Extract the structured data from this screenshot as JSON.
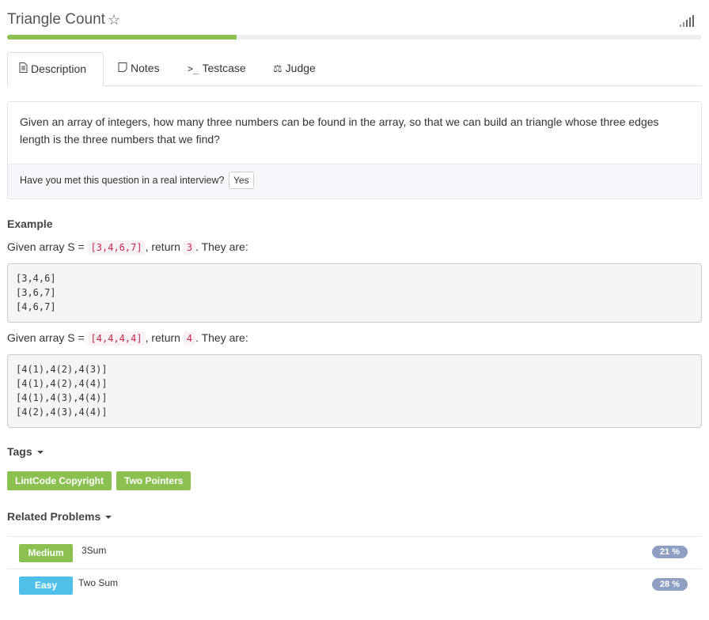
{
  "problem": {
    "title": "Triangle Count",
    "star_icon": "star-icon",
    "difficulty_icon": "signal-bars-icon",
    "progress_fraction": 0.33
  },
  "tabs": [
    {
      "label": "Description",
      "icon": "document-icon",
      "active": true
    },
    {
      "label": "Notes",
      "icon": "note-icon",
      "active": false
    },
    {
      "label": "Testcase",
      "icon": "terminal-icon",
      "active": false
    },
    {
      "label": "Judge",
      "icon": "scale-icon",
      "active": false
    }
  ],
  "description": {
    "text": "Given an array of integers, how many three numbers can be found in the array, so that we can build an triangle whose three edges length is the three numbers that we find?",
    "interview_question": "Have you met this question in a real interview?",
    "yes_label": "Yes"
  },
  "example": {
    "heading": "Example",
    "cases": [
      {
        "prefix": "Given array S = ",
        "array": "[3,4,6,7]",
        "middle": ", return ",
        "result": "3",
        "suffix": ". They are:",
        "lines": [
          "[3,4,6]",
          "[3,6,7]",
          "[4,6,7]"
        ]
      },
      {
        "prefix": "Given array S = ",
        "array": "[4,4,4,4]",
        "middle": ", return ",
        "result": "4",
        "suffix": ". They are:",
        "lines": [
          "[4(1),4(2),4(3)]",
          "[4(1),4(2),4(4)]",
          "[4(1),4(3),4(4)]",
          "[4(2),4(3),4(4)]"
        ]
      }
    ]
  },
  "tags": {
    "heading": "Tags",
    "items": [
      "LintCode Copyright",
      "Two Pointers"
    ]
  },
  "related": {
    "heading": "Related Problems",
    "items": [
      {
        "difficulty": "Medium",
        "name": "3Sum",
        "percent": "21 %",
        "color": "#8cc152"
      },
      {
        "difficulty": "Easy",
        "name": "Two Sum",
        "percent": "28 %",
        "color": "#4fc1e9"
      }
    ]
  },
  "colors": {
    "accent_green": "#8cc152",
    "easy_blue": "#4fc1e9",
    "percent_badge": "#8e9fc2",
    "code_red": "#c7254e"
  }
}
